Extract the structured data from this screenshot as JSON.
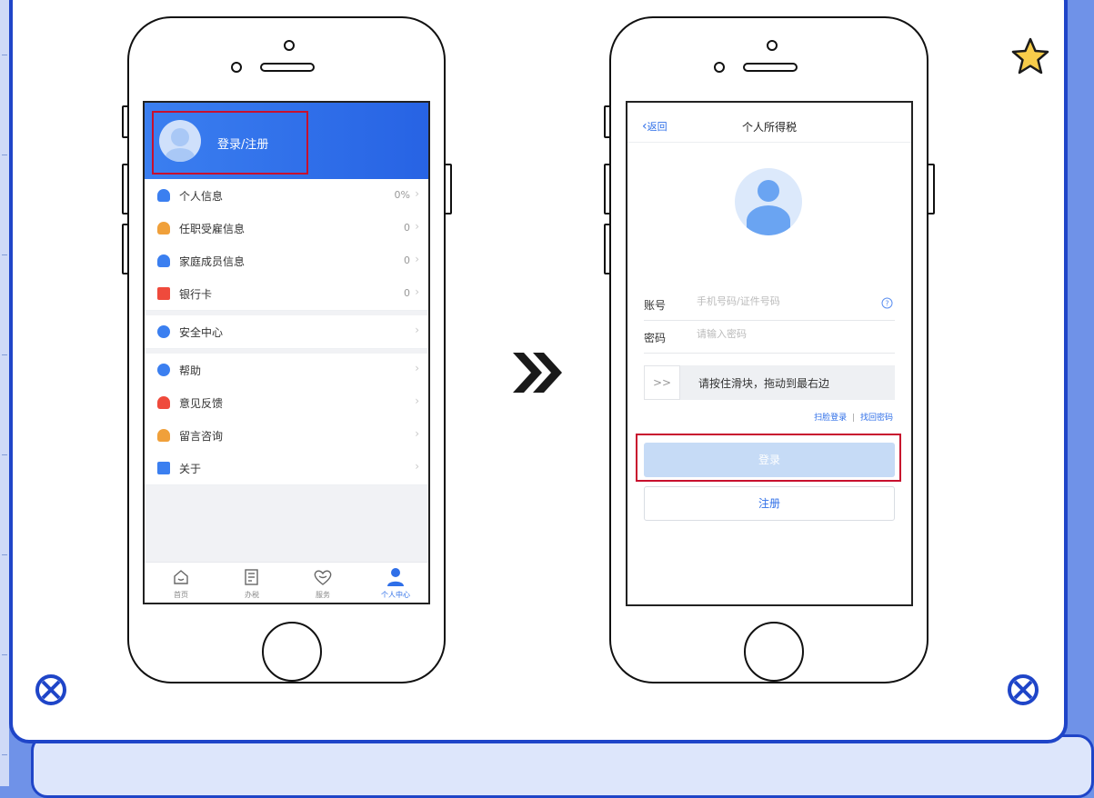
{
  "left_phone": {
    "login_label": "登录/注册",
    "menu": [
      {
        "label": "个人信息",
        "value": "0%",
        "icon": "person-icon"
      },
      {
        "label": "任职受雇信息",
        "value": "0",
        "icon": "employment-icon"
      },
      {
        "label": "家庭成员信息",
        "value": "0",
        "icon": "family-icon"
      },
      {
        "label": "银行卡",
        "value": "0",
        "icon": "bank-card-icon"
      },
      {
        "label": "安全中心",
        "icon": "shield-icon"
      },
      {
        "label": "帮助",
        "icon": "help-icon"
      },
      {
        "label": "意见反馈",
        "icon": "pen-icon"
      },
      {
        "label": "留言咨询",
        "icon": "headset-icon"
      },
      {
        "label": "关于",
        "icon": "document-icon"
      }
    ],
    "tabs": [
      {
        "label": "首页",
        "icon": "home-icon"
      },
      {
        "label": "办税",
        "icon": "tax-form-icon"
      },
      {
        "label": "服务",
        "icon": "service-heart-icon"
      },
      {
        "label": "个人中心",
        "icon": "user-center-icon",
        "active": true
      }
    ]
  },
  "right_phone": {
    "back_label": "返回",
    "title": "个人所得税",
    "account_label": "账号",
    "account_placeholder": "手机号码/证件号码",
    "password_label": "密码",
    "password_placeholder": "请输入密码",
    "slider_arrows": ">>",
    "slider_text": "请按住滑块，拖动到最右边",
    "scan_login": "扫脸登录",
    "link_separator": "|",
    "forgot_password": "找回密码",
    "login_button": "登录",
    "register_button": "注册"
  },
  "colors": {
    "brand_blue": "#2f6fe8",
    "highlight_red": "#c8102e",
    "frame_blue": "#1f45c8"
  }
}
